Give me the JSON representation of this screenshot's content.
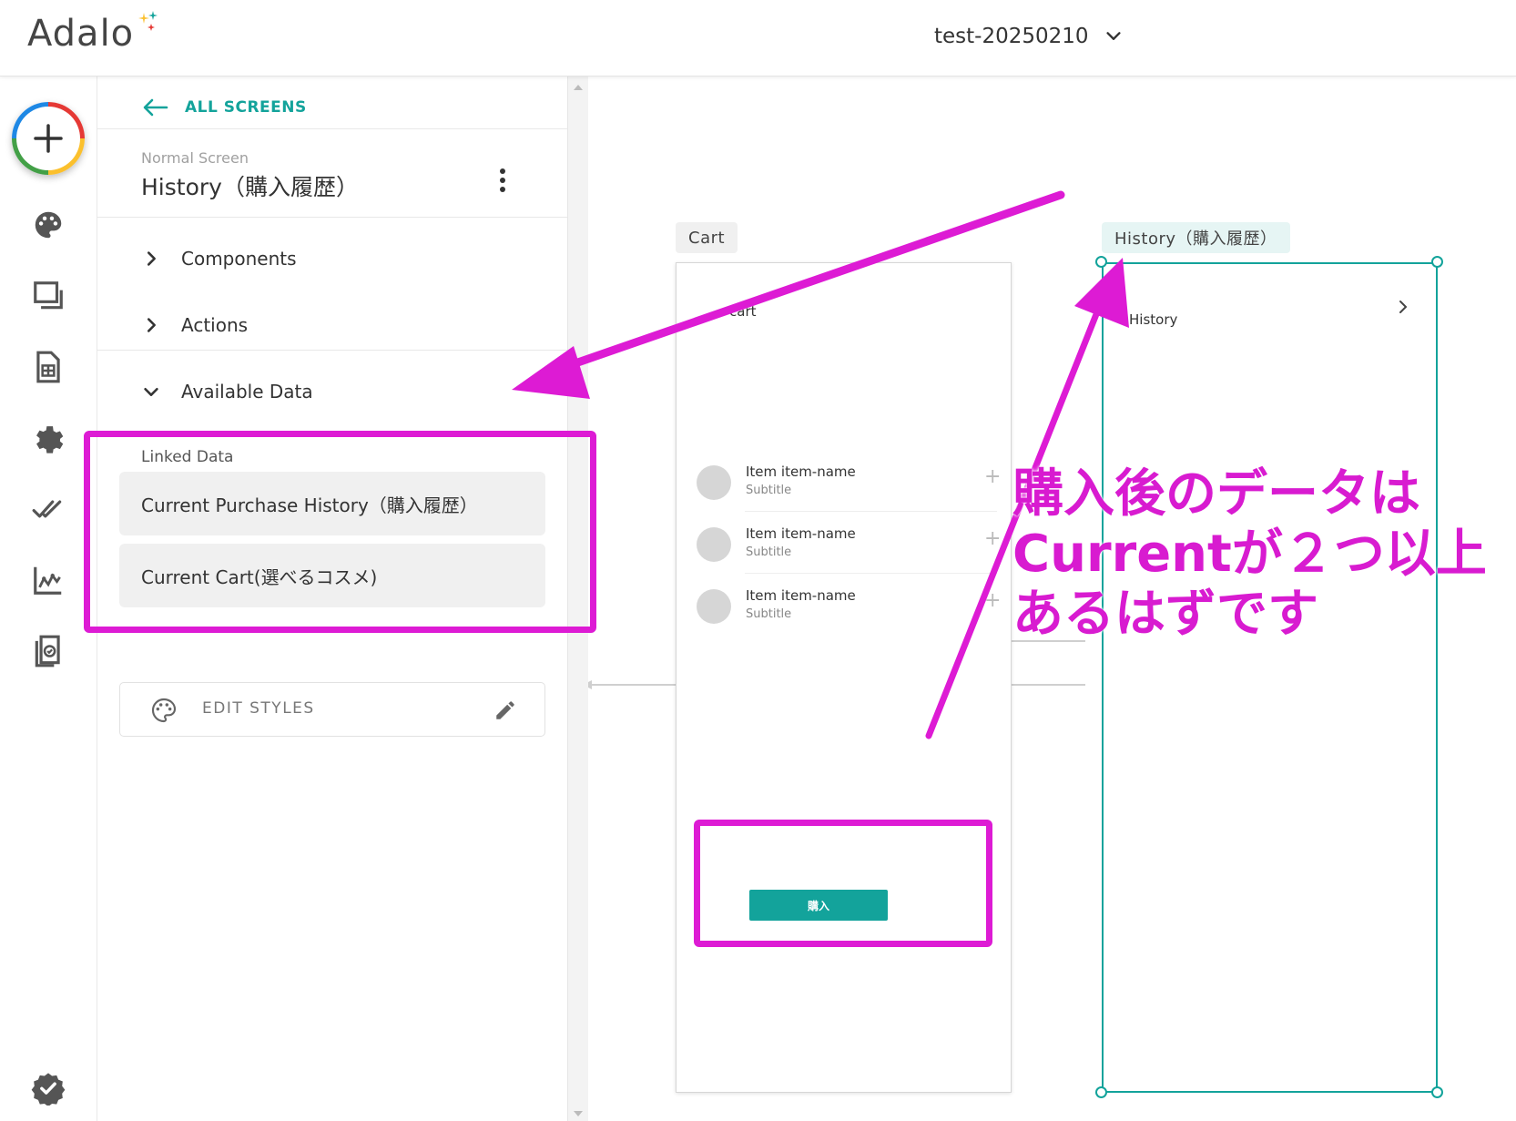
{
  "app": {
    "logo": "Adalo",
    "project_name": "test-20250210"
  },
  "panel": {
    "back_label": "ALL SCREENS",
    "screen_type": "Normal Screen",
    "screen_title": "History（購入履歴）",
    "sections": {
      "components": "Components",
      "actions": "Actions",
      "available_data": "Available Data"
    },
    "linked_data_label": "Linked Data",
    "linked_items": [
      "Current Purchase History（購入履歴）",
      "Current Cart(選べるコスメ)"
    ],
    "edit_styles_label": "EDIT STYLES"
  },
  "canvas": {
    "cart_screen": {
      "tag": "Cart",
      "header_text": "cart",
      "items": [
        {
          "title": "Item item-name",
          "subtitle": "Subtitle"
        },
        {
          "title": "Item item-name",
          "subtitle": "Subtitle"
        },
        {
          "title": "Item item-name",
          "subtitle": "Subtitle"
        }
      ],
      "buy_button": "購入"
    },
    "history_screen": {
      "tag": "History（購入履歴）",
      "header_text": "History"
    }
  },
  "annotation": {
    "lines": [
      "購入後のデータは",
      "Currentが２つ以上",
      "あるはずです"
    ]
  },
  "colors": {
    "accent": "#13a39b",
    "highlight": "#dd1bd4"
  }
}
